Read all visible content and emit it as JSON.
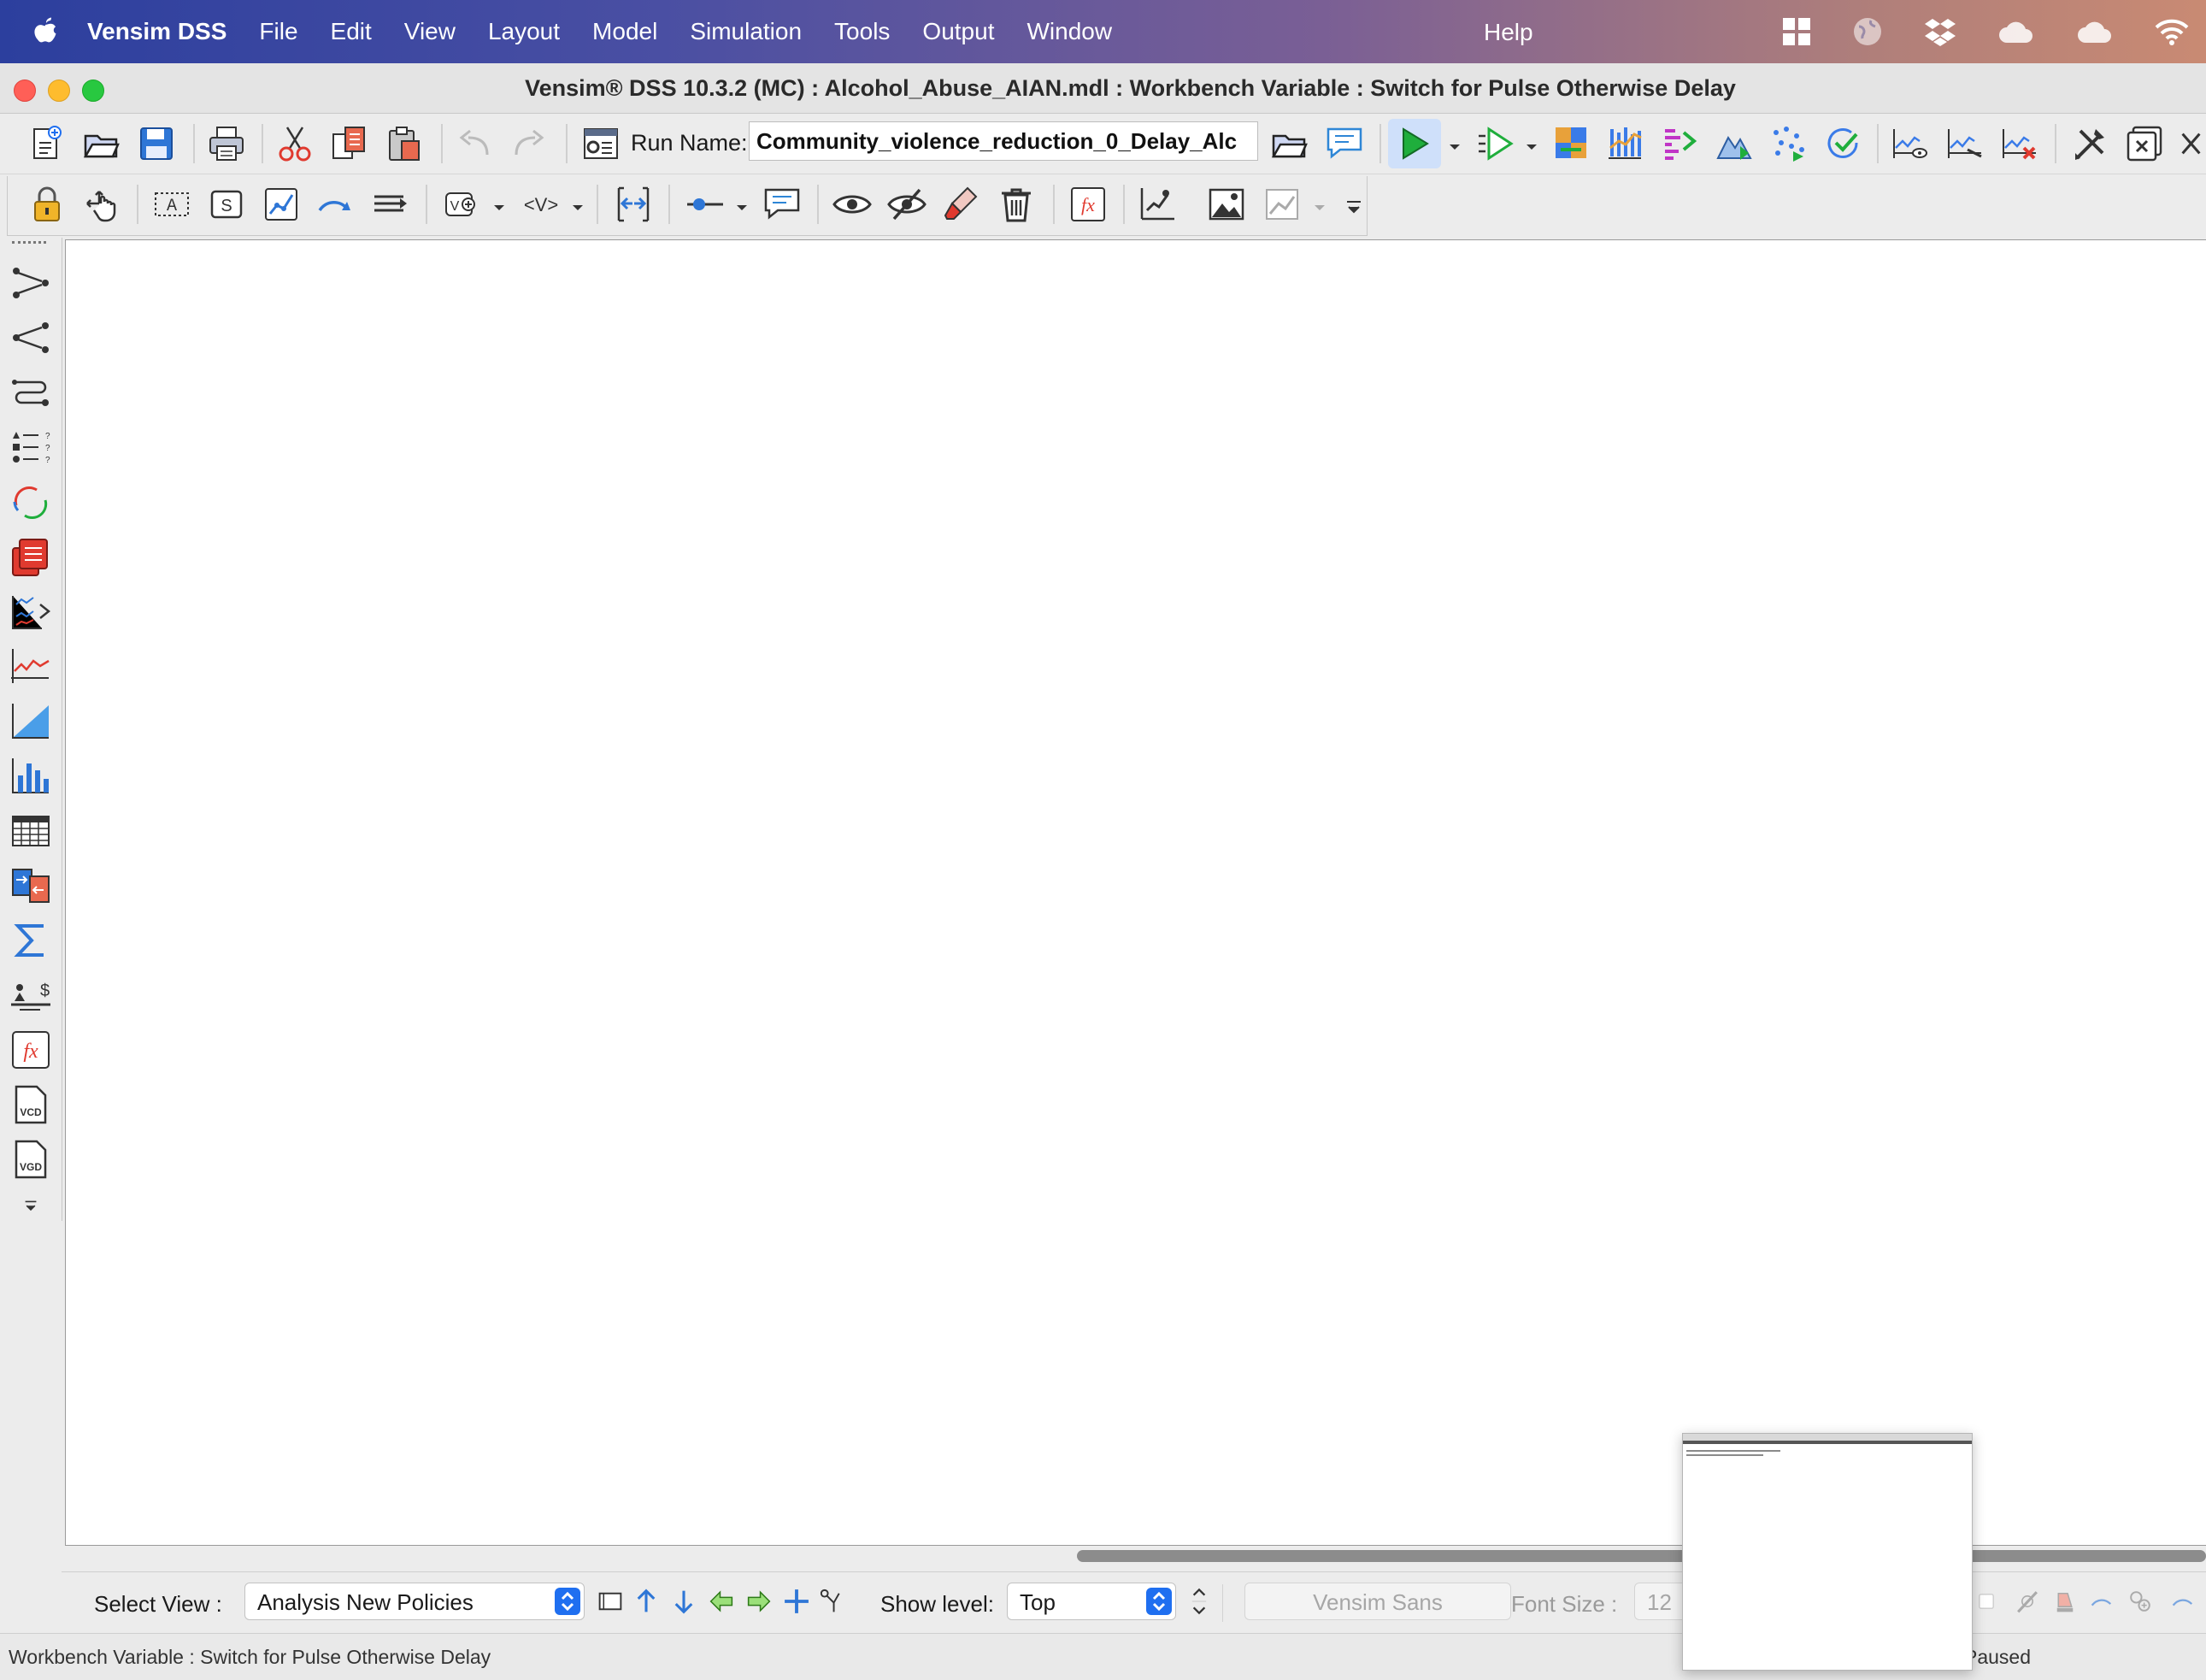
{
  "menubar": {
    "app_name": "Vensim DSS",
    "items": [
      "File",
      "Edit",
      "View",
      "Layout",
      "Model",
      "Simulation",
      "Tools",
      "Output",
      "Window"
    ],
    "help": "Help",
    "tray_icons": [
      "windows-grid-icon",
      "globe-icon",
      "dropbox-icon",
      "cloud-icon",
      "cloud-icon",
      "wifi-icon"
    ]
  },
  "window": {
    "title": "Vensim® DSS 10.3.2 (MC) : Alcohol_Abuse_AIAN.mdl : Workbench Variable : Switch for Pulse Otherwise Delay"
  },
  "toolbar": {
    "run_name_label": "Run Name:",
    "run_name_value": "Community_violence_reduction_0_Delay_Alc"
  },
  "bottom_bar": {
    "select_view_label": "Select View :",
    "select_view_value": "Analysis New Policies",
    "show_level_label": "Show level:",
    "show_level_value": "Top",
    "font_name": "Vensim Sans",
    "font_size_label": "Font Size :",
    "font_size_value": "12"
  },
  "status_bar": {
    "left_text": "Workbench Variable : Switch for Pulse Otherwise Delay",
    "right_text": "Paused"
  },
  "colors": {
    "accent_blue": "#1f6ff0",
    "run_green": "#1fae3c",
    "delete_red": "#e03a2f"
  }
}
